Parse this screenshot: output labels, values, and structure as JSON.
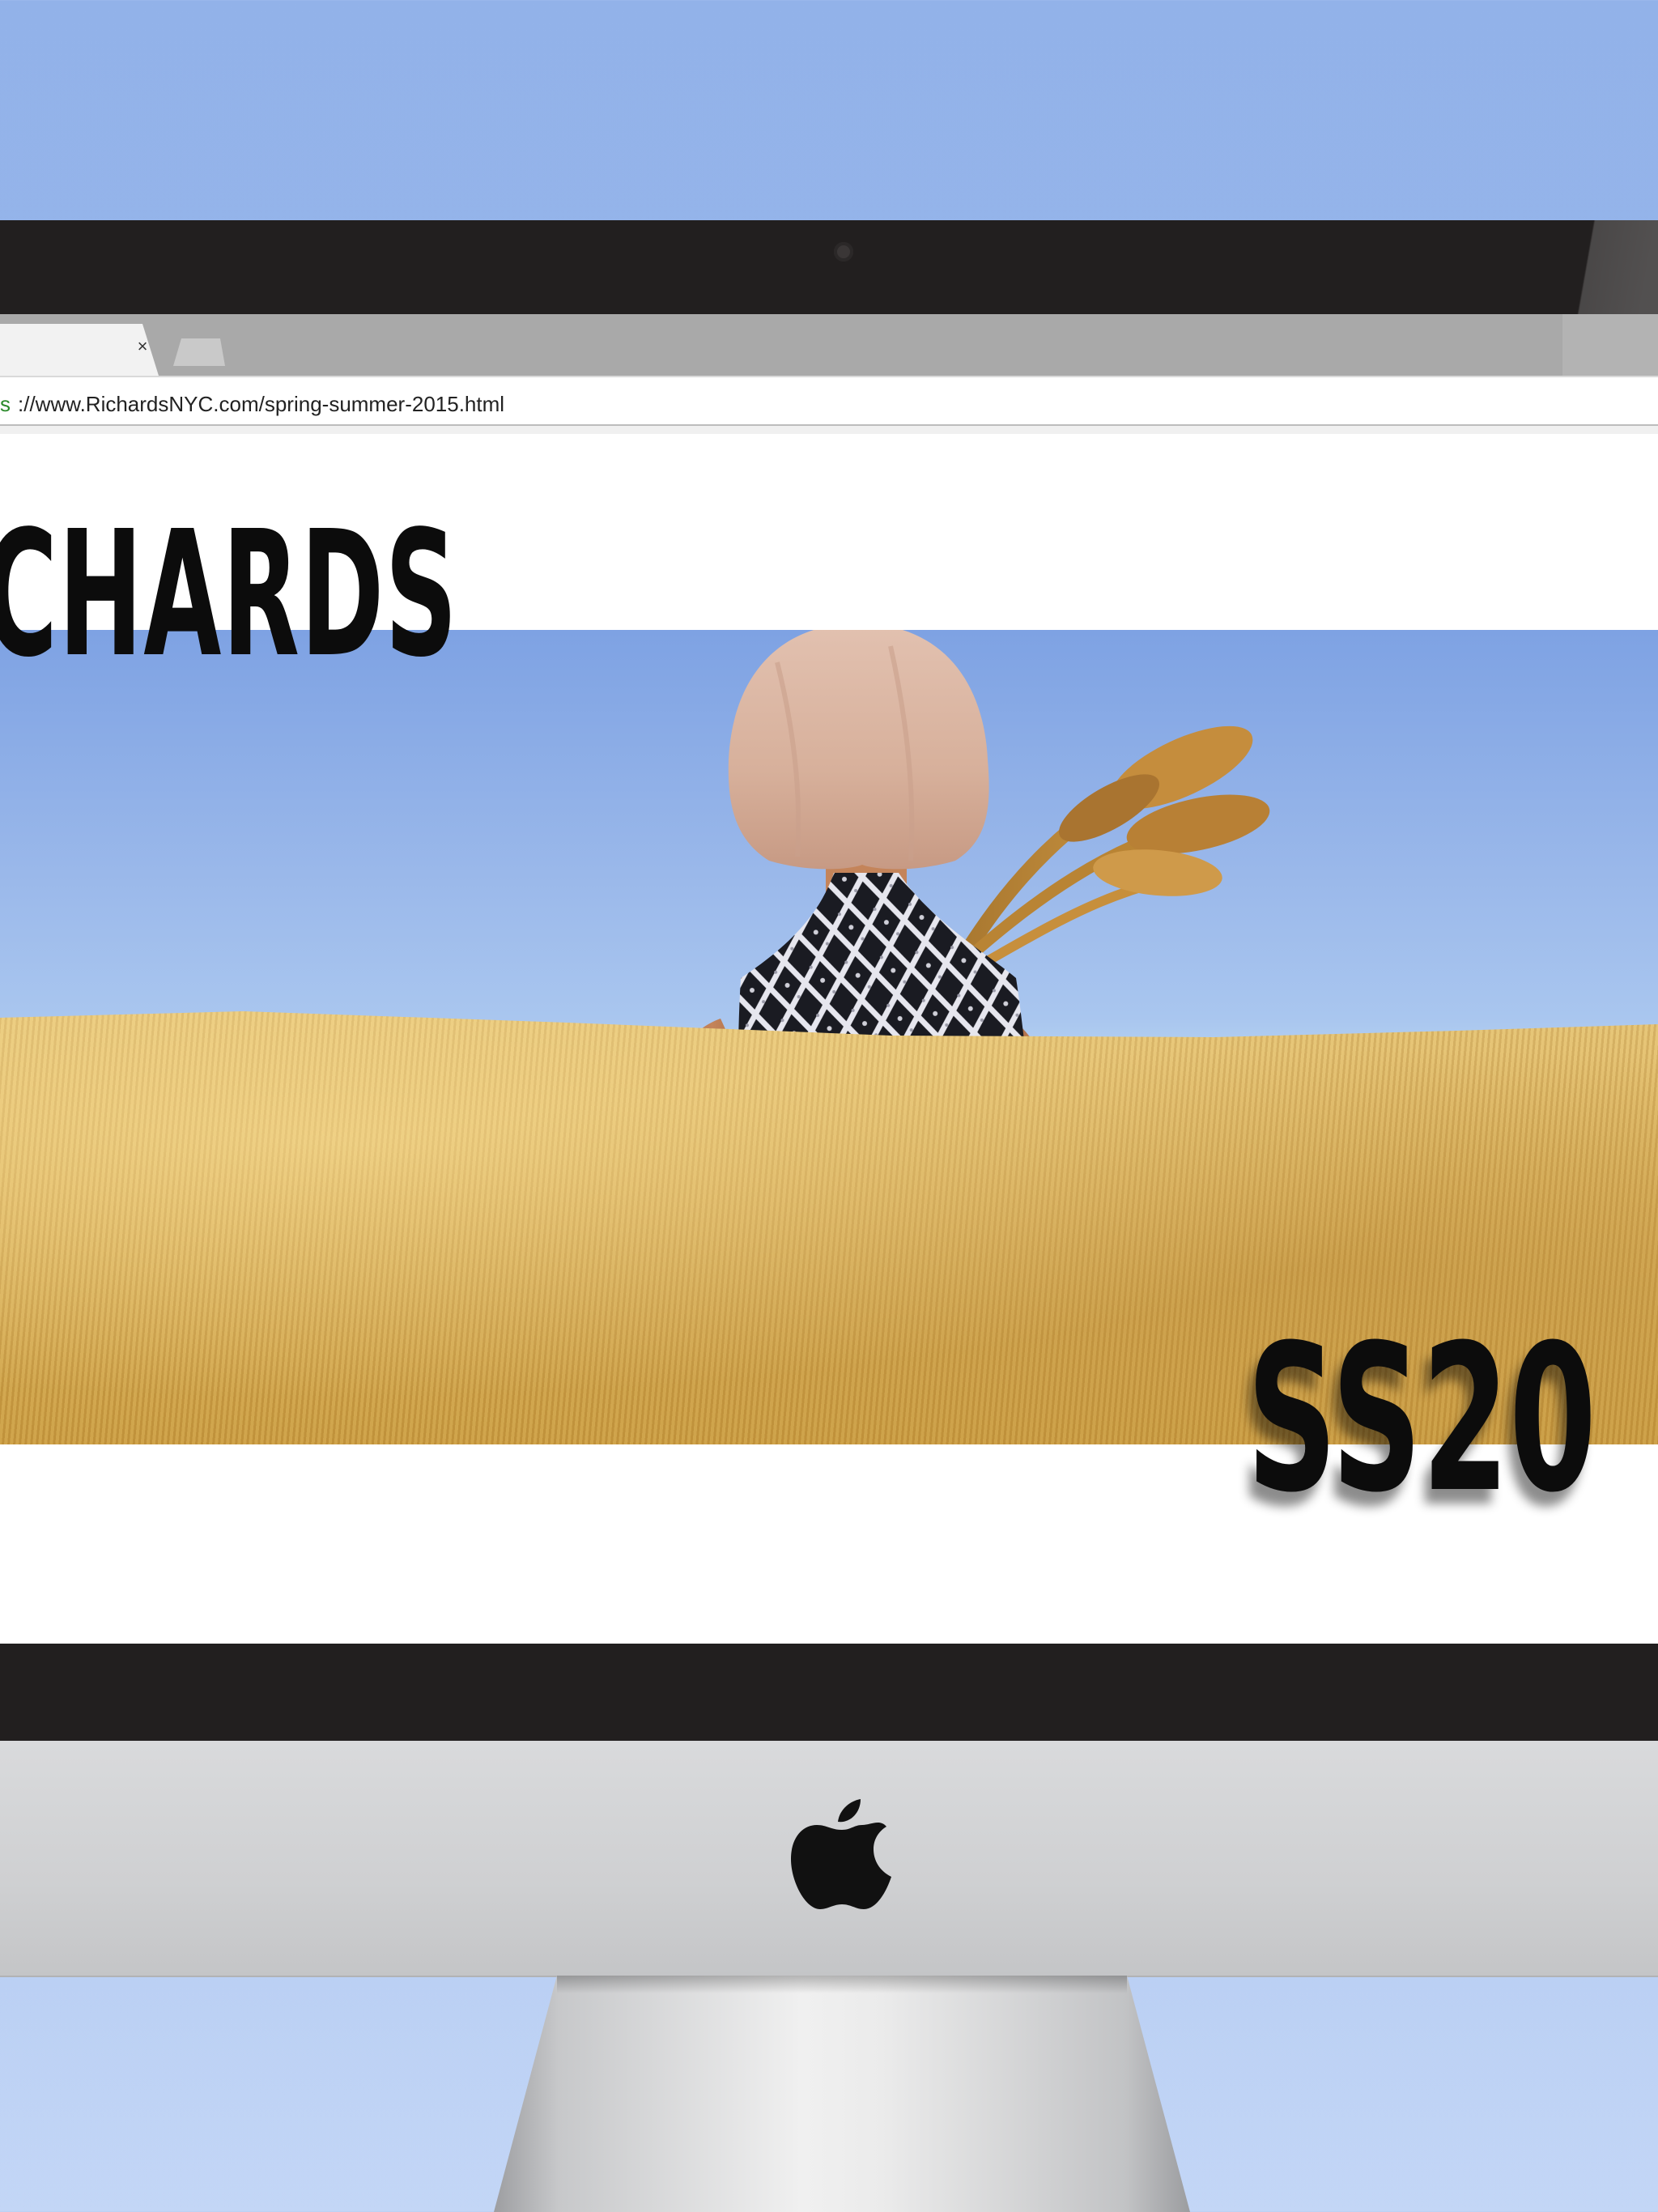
{
  "browser": {
    "tab": {
      "close_glyph": "×"
    },
    "address": {
      "scheme": "s",
      "url_rest": "://www.RichardsNYC.com/spring-summer-2015.html"
    }
  },
  "page": {
    "brand_title": "CHARDS",
    "season_text": "SS20"
  },
  "device": {
    "logo_icon": "apple-logo-icon",
    "webcam_icon": "webcam-icon"
  },
  "colors": {
    "background_sky": "#92b2e9",
    "bezel": "#221f1f",
    "tab_strip": "#a9a9a9",
    "page_bg": "#ffffff",
    "chin": "#d3d4d6",
    "title_text": "#0c0c0c"
  }
}
